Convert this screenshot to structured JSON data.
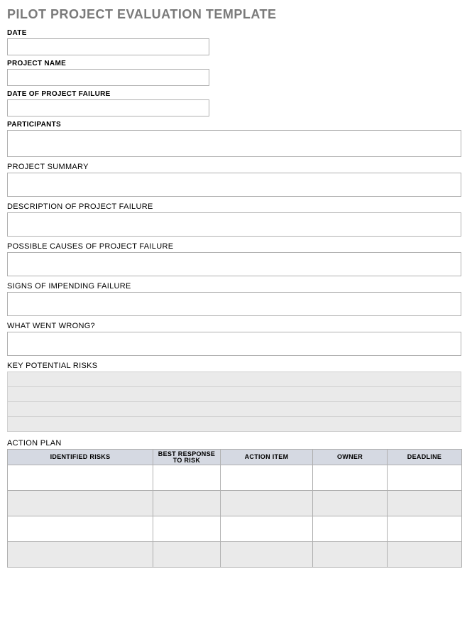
{
  "title": "PILOT PROJECT EVALUATION TEMPLATE",
  "fields": {
    "date": {
      "label": "DATE",
      "value": ""
    },
    "projectName": {
      "label": "PROJECT NAME",
      "value": ""
    },
    "dateOfFailure": {
      "label": "DATE OF PROJECT FAILURE",
      "value": ""
    },
    "participants": {
      "label": "PARTICIPANTS",
      "value": ""
    },
    "projectSummary": {
      "label": "PROJECT SUMMARY",
      "value": ""
    },
    "descriptionOfFailure": {
      "label": "DESCRIPTION OF PROJECT FAILURE",
      "value": ""
    },
    "possibleCauses": {
      "label": "POSSIBLE CAUSES OF PROJECT FAILURE",
      "value": ""
    },
    "signsOfImpending": {
      "label": "SIGNS OF IMPENDING FAILURE",
      "value": ""
    },
    "whatWentWrong": {
      "label": "WHAT WENT WRONG?",
      "value": ""
    },
    "keyPotentialRisks": {
      "label": "KEY POTENTIAL RISKS"
    },
    "actionPlan": {
      "label": "ACTION PLAN"
    }
  },
  "risksRows": [
    "",
    "",
    "",
    ""
  ],
  "actionPlanHeaders": {
    "identifiedRisks": "IDENTIFIED RISKS",
    "bestResponse": "BEST RESPONSE TO RISK",
    "actionItem": "ACTION ITEM",
    "owner": "OWNER",
    "deadline": "DEADLINE"
  },
  "actionPlanRows": [
    {
      "identifiedRisks": "",
      "bestResponse": "",
      "actionItem": "",
      "owner": "",
      "deadline": ""
    },
    {
      "identifiedRisks": "",
      "bestResponse": "",
      "actionItem": "",
      "owner": "",
      "deadline": ""
    },
    {
      "identifiedRisks": "",
      "bestResponse": "",
      "actionItem": "",
      "owner": "",
      "deadline": ""
    },
    {
      "identifiedRisks": "",
      "bestResponse": "",
      "actionItem": "",
      "owner": "",
      "deadline": ""
    }
  ]
}
